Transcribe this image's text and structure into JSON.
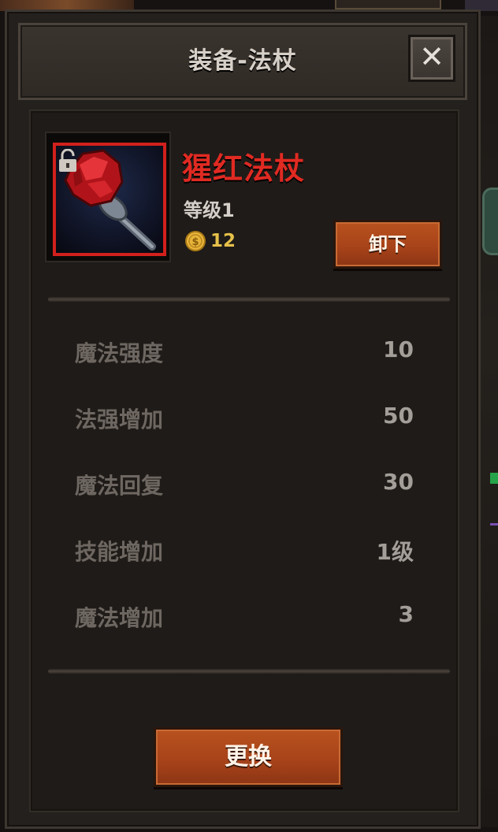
{
  "dialog": {
    "title": "装备-法杖",
    "close_symbol": "✕"
  },
  "item": {
    "name": "猩红法杖",
    "level": "等级1",
    "price": "12",
    "name_color": "#e02a22",
    "icon": "scarlet-staff-icon",
    "lock_icon": "unlocked-padlock-icon",
    "coin_icon": "gold-coin-icon"
  },
  "buttons": {
    "unequip": "卸下",
    "replace": "更换"
  },
  "stats": [
    {
      "label": "魔法强度",
      "value": "10"
    },
    {
      "label": "法强增加",
      "value": "50"
    },
    {
      "label": "魔法回复",
      "value": "30"
    },
    {
      "label": "技能增加",
      "value": "1级"
    },
    {
      "label": "魔法增加",
      "value": "3"
    }
  ],
  "colors": {
    "button": "#a8431a",
    "coin_text": "#e6c14a",
    "panel": "#1f1b18"
  }
}
